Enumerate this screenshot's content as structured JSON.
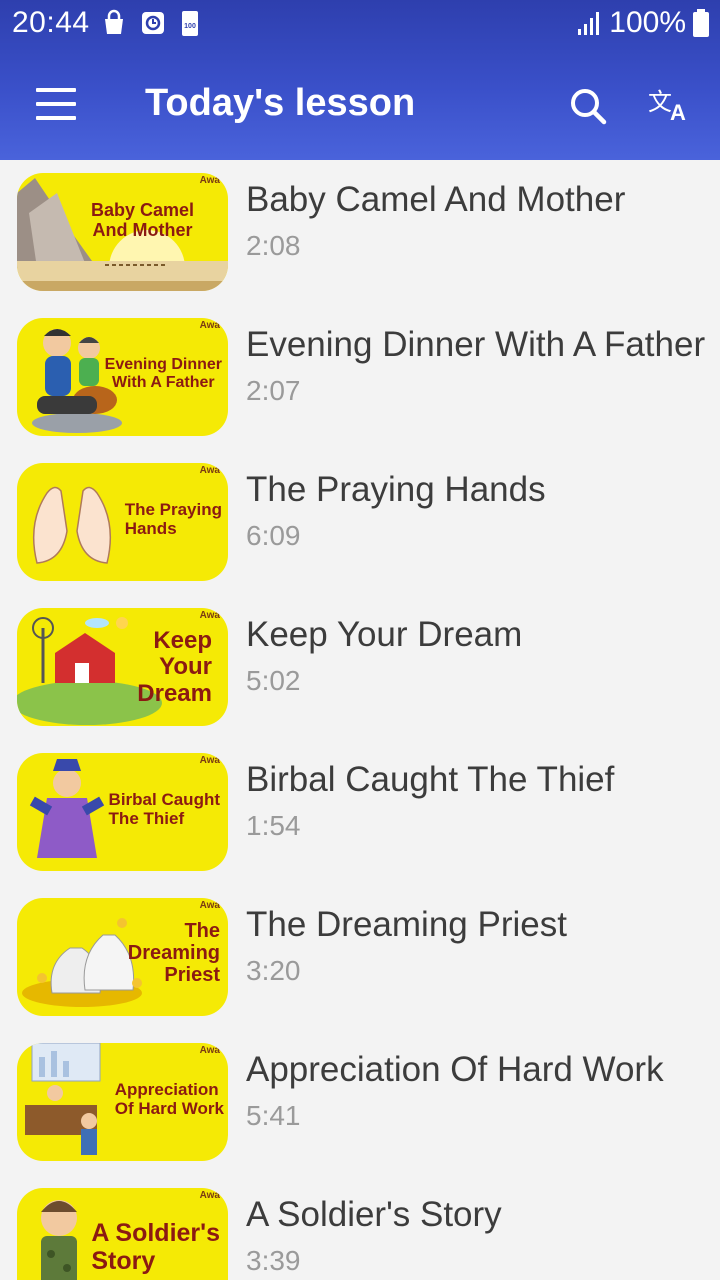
{
  "status_bar": {
    "time": "20:44",
    "battery": "100%",
    "battery_badge": "100",
    "icons": [
      "bag-icon",
      "clock-app-icon",
      "battery-saver-icon",
      "signal-icon",
      "battery-icon"
    ]
  },
  "app_bar": {
    "title": "Today's lesson",
    "menu_icon": "hamburger-menu-icon",
    "search_icon": "search-icon",
    "translate_icon": "translate-icon",
    "background_color": "#3a4fc7"
  },
  "thumbnail_brand": "Awa",
  "lessons": [
    {
      "title": "Baby Camel And Mother",
      "duration": "2:08",
      "thumb_text": "Baby Camel\nAnd Mother"
    },
    {
      "title": "Evening Dinner With A Father",
      "duration": "2:07",
      "thumb_text": "Evening Dinner\nWith A Father"
    },
    {
      "title": "The Praying Hands",
      "duration": "6:09",
      "thumb_text": "The Praying\nHands"
    },
    {
      "title": "Keep Your Dream",
      "duration": "5:02",
      "thumb_text": "Keep\nYour\nDream"
    },
    {
      "title": "Birbal Caught The Thief",
      "duration": "1:54",
      "thumb_text": "Birbal Caught\nThe Thief"
    },
    {
      "title": "The Dreaming Priest",
      "duration": "3:20",
      "thumb_text": "The\nDreaming\nPriest"
    },
    {
      "title": "Appreciation Of Hard Work",
      "duration": "5:41",
      "thumb_text": "Appreciation\nOf Hard Work"
    },
    {
      "title": "A Soldier's Story",
      "duration": "3:39",
      "thumb_text": "A Soldier's\nStory"
    }
  ],
  "colors": {
    "thumb_background": "#f5ea05",
    "thumb_text": "#8b1a12",
    "title_text": "#3c3c3c",
    "duration_text": "#9a9a9a",
    "list_background": "#f3f3f3"
  }
}
